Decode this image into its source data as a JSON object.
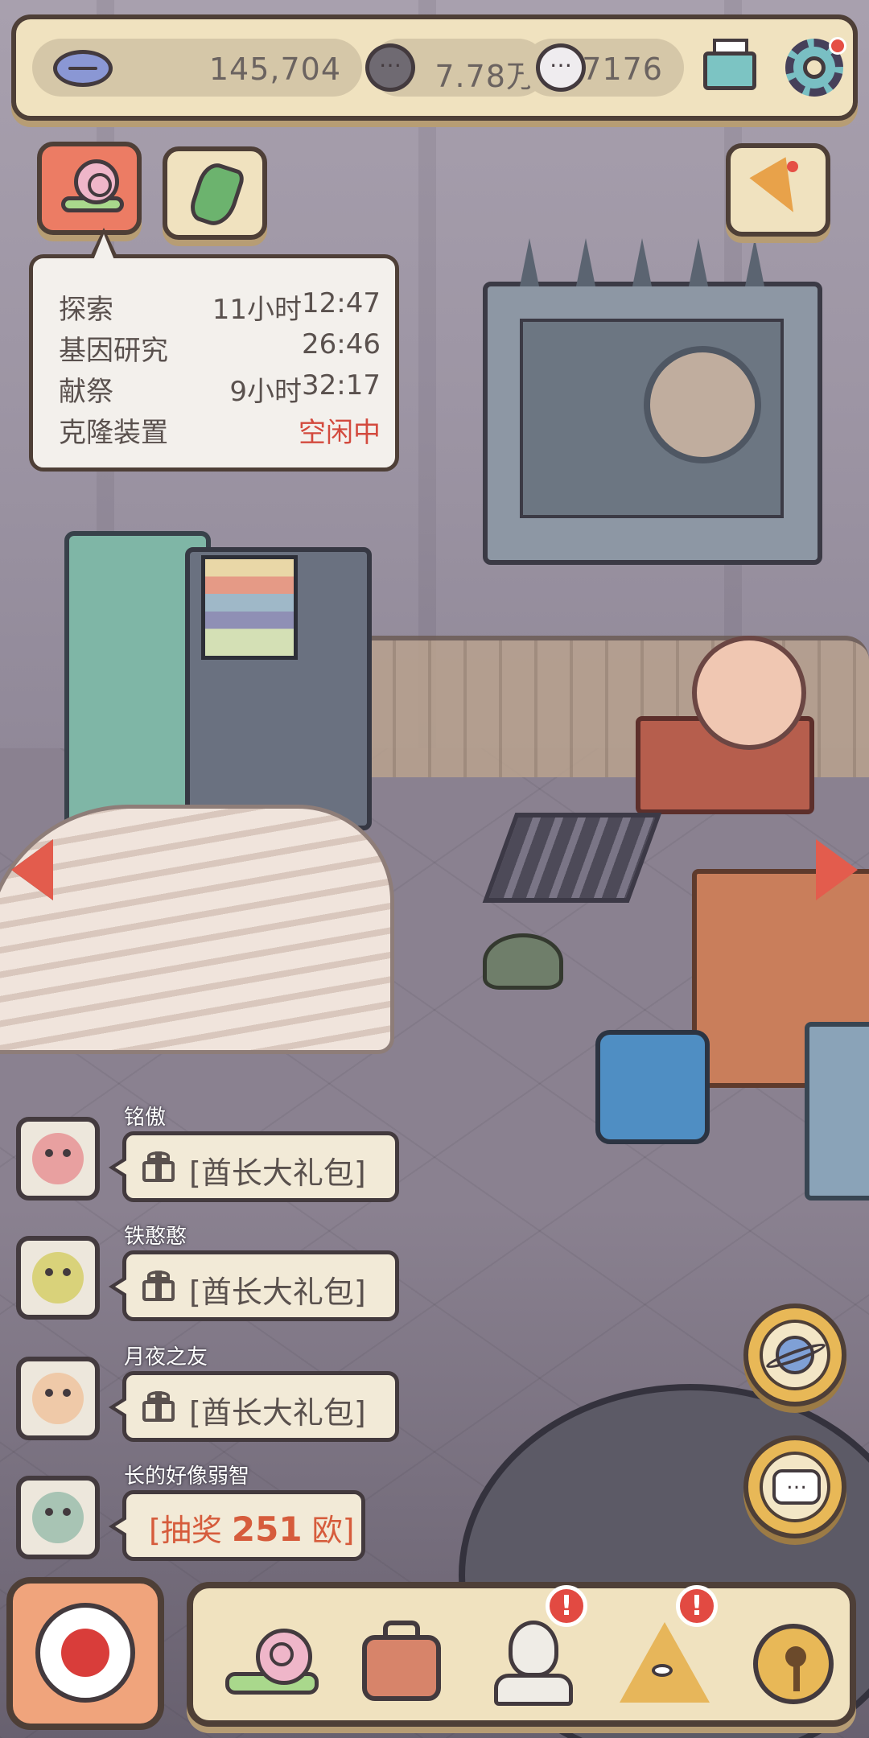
{
  "resources": {
    "mouth_icon": "lips-icon",
    "primary_value": "145,704",
    "secondary_value": "7.78万",
    "tertiary_value": "7176"
  },
  "header_icons": {
    "mail": "mail-icon",
    "settings": "gear-icon",
    "settings_notification_color": "#e54f45"
  },
  "top_buttons": {
    "left": [
      "snail-icon",
      "map-icon"
    ],
    "right": [
      "party-popper-icon"
    ]
  },
  "tooltip": {
    "rows": [
      {
        "label": "探索",
        "duration": "11小时",
        "time": "12:47"
      },
      {
        "label": "基因研究",
        "duration": "",
        "time": "26:46"
      },
      {
        "label": "献祭",
        "duration": "9小时",
        "time": "32:17"
      },
      {
        "label": "克隆装置",
        "duration": "",
        "time": "空闲中"
      }
    ],
    "idle_color": "#d34a3e"
  },
  "chat": [
    {
      "name": "铭傲",
      "message": "[酋长大礼包]",
      "type": "gift"
    },
    {
      "name": "铁憨憨",
      "message": "[酋长大礼包]",
      "type": "gift"
    },
    {
      "name": "月夜之友",
      "message": "[酋长大礼包]",
      "type": "gift"
    },
    {
      "name": "长的好像弱智",
      "prefix": "[抽奖 ",
      "number": "251",
      "suffix": " 欧]",
      "type": "lottery"
    }
  ],
  "side_buttons": [
    "planet-icon",
    "chat-bubble-icon"
  ],
  "bottom_nav": {
    "record_button": "record-icon",
    "items": [
      {
        "icon": "snail-icon",
        "badge": ""
      },
      {
        "icon": "suitcase-icon",
        "badge": ""
      },
      {
        "icon": "statue-bust-icon",
        "badge": "!"
      },
      {
        "icon": "pyramid-eye-icon",
        "badge": "!"
      },
      {
        "icon": "key-coin-icon",
        "badge": ""
      }
    ]
  },
  "colors": {
    "panel": "#f0e2bf",
    "outline": "#4e3f37",
    "accent_red": "#e35c4d",
    "badge_red": "#e24a42"
  }
}
